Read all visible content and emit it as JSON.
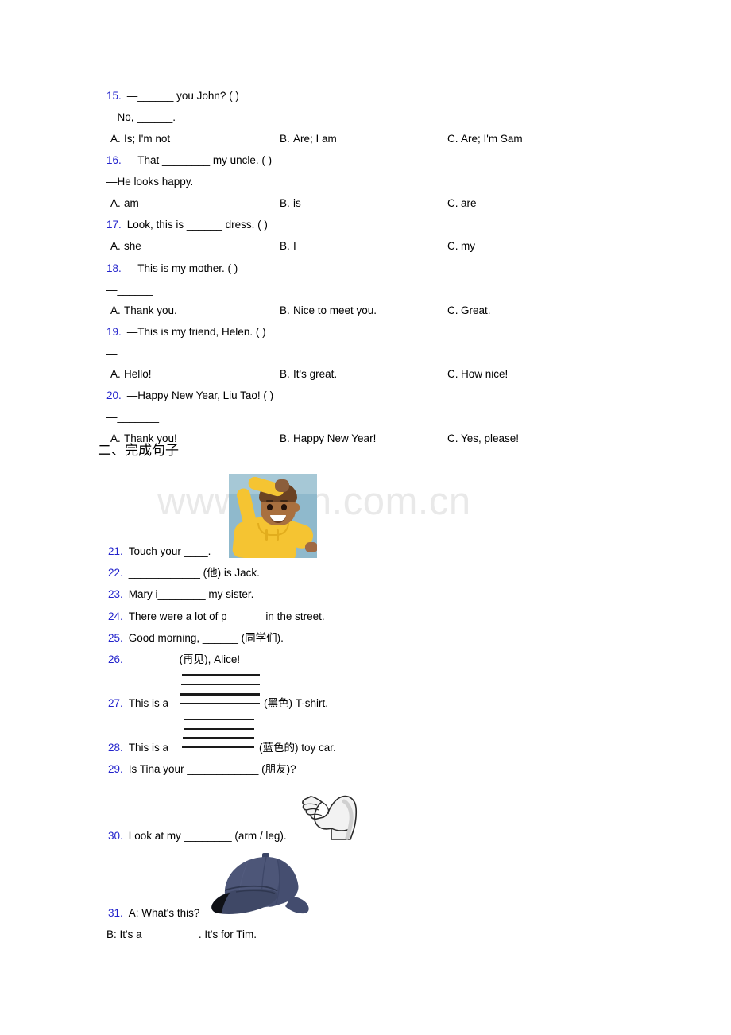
{
  "watermark": {
    "text": "www.zixin.com.cn",
    "color": "#e9e9e9"
  },
  "accent": {
    "question_number_color": "#2222cc"
  },
  "section_one_tail": {
    "questions": [
      {
        "number": "15.",
        "lines": [
          "—______ you John? (  )",
          "—No, ______."
        ],
        "options": [
          {
            "letter": "A.",
            "text": "Is; I'm not"
          },
          {
            "letter": "B.",
            "text": "Are; I am"
          },
          {
            "letter": "C.",
            "text": "Are; I'm Sam"
          }
        ]
      },
      {
        "number": "16.",
        "lines": [
          "—That ________ my uncle. (  )",
          "—He looks happy."
        ],
        "options": [
          {
            "letter": "A.",
            "text": "am"
          },
          {
            "letter": "B.",
            "text": "is"
          },
          {
            "letter": "C.",
            "text": "are"
          }
        ]
      },
      {
        "number": "17.",
        "lines": [
          "Look, this is ______ dress. (  )"
        ],
        "options": [
          {
            "letter": "A.",
            "text": "she"
          },
          {
            "letter": "B.",
            "text": "I"
          },
          {
            "letter": "C.",
            "text": "my"
          }
        ]
      },
      {
        "number": "18.",
        "lines": [
          "—This is my mother. (  )",
          "—______"
        ],
        "options": [
          {
            "letter": "A.",
            "text": "Thank you."
          },
          {
            "letter": "B.",
            "text": "Nice to meet you."
          },
          {
            "letter": "C.",
            "text": "Great."
          }
        ]
      },
      {
        "number": "19.",
        "lines": [
          "—This is my friend, Helen. (  )",
          "—________"
        ],
        "options": [
          {
            "letter": "A.",
            "text": "Hello!"
          },
          {
            "letter": "B.",
            "text": "It's great."
          },
          {
            "letter": "C.",
            "text": "How nice!"
          }
        ]
      },
      {
        "number": "20.",
        "lines": [
          "—Happy New Year, Liu Tao! (  )",
          "—_______"
        ],
        "options": [
          {
            "letter": "A.",
            "text": "Thank you!"
          },
          {
            "letter": "B.",
            "text": "Happy New Year!"
          },
          {
            "letter": "C.",
            "text": "Yes, please!"
          }
        ]
      }
    ]
  },
  "section_two": {
    "heading": "二、完成句子",
    "questions": [
      {
        "number": "21.",
        "text": "Touch your ____."
      },
      {
        "number": "22.",
        "text": "____________ (他) is Jack."
      },
      {
        "number": "23.",
        "text": "Mary i________ my sister."
      },
      {
        "number": "24.",
        "text": "There were a lot of p______ in the street."
      },
      {
        "number": "25.",
        "text": "Good morning, ______ (同学们)."
      },
      {
        "number": "26.",
        "text": "________ (再见), Alice!"
      },
      {
        "number": "27.",
        "text_before": "This is a",
        "text_after": "(黑色) T-shirt."
      },
      {
        "number": "28.",
        "text_before": "This is a",
        "text_after": "(蓝色的) toy car."
      },
      {
        "number": "29.",
        "text": "Is Tina your ____________ (朋友)?"
      },
      {
        "number": "30.",
        "text": "Look at my ________ (arm / leg)."
      },
      {
        "number": "31.",
        "text": "A: What's this?",
        "text_line2": "B: It's a _________. It's for Tim."
      }
    ]
  },
  "artwork": {
    "boy": "boy-touching-head-illustration",
    "arm": "flexed-arm-illustration",
    "cap": "navy-baseball-cap-illustration"
  }
}
